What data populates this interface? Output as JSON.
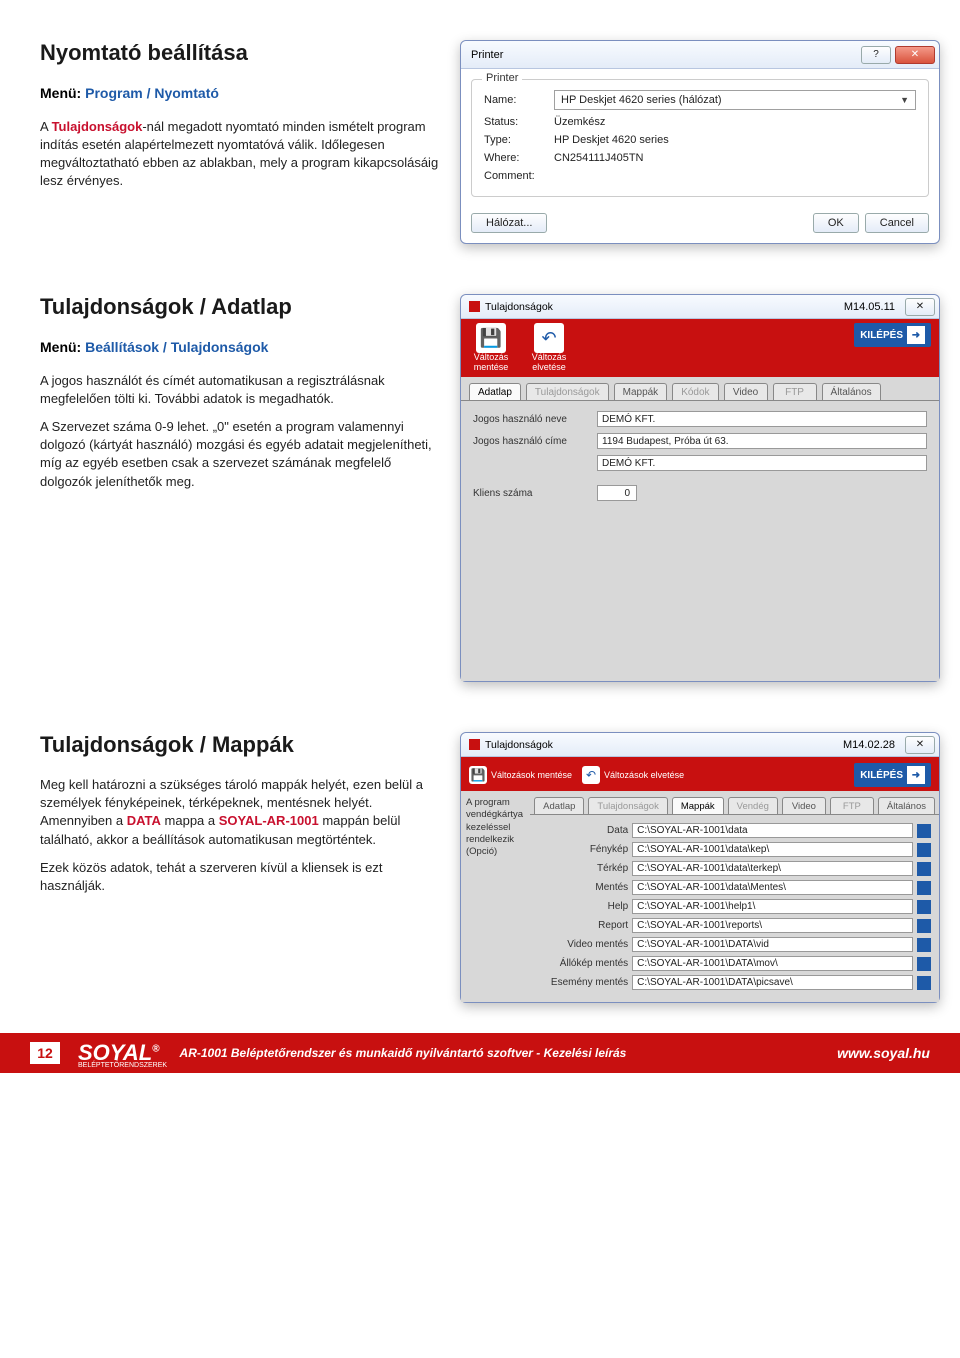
{
  "section1": {
    "heading": "Nyomtató beállítása",
    "menu_label": "Menü:",
    "menu_value": "Program / Nyomtató",
    "p1_pre": "A ",
    "p1_bold": "Tulajdonságok",
    "p1_rest": "-nál megadott nyomtató minden ismételt program indítás esetén alapértelmezett nyomtatóvá válik. Időlegesen megváltoztatható ebben az ablakban, mely a program kikapcsolásáig lesz érvényes."
  },
  "printer_dialog": {
    "title": "Printer",
    "legend": "Printer",
    "name_label": "Name:",
    "name_value": "HP Deskjet 4620 series (hálózat)",
    "status_label": "Status:",
    "status_value": "Üzemkész",
    "type_label": "Type:",
    "type_value": "HP Deskjet 4620 series",
    "where_label": "Where:",
    "where_value": "CN254111J405TN",
    "comment_label": "Comment:",
    "halozat_btn": "Hálózat...",
    "ok_btn": "OK",
    "cancel_btn": "Cancel",
    "help_char": "?"
  },
  "section2": {
    "heading": "Tulajdonságok / Adatlap",
    "menu_label": "Menü:",
    "menu_value": "Beállítások / Tulajdonságok",
    "p1": "A jogos használót és címét automatikusan a regisztrálásnak megfelelően tölti ki. További adatok is megadhatók.",
    "p2": "A Szervezet száma 0-9 lehet. „0\" esetén a program valamennyi dolgozó (kártyát használó) mozgási és egyéb adatait megjelenítheti, míg az egyéb esetben csak a szervezet számának megfelelő dolgozók jeleníthetők meg."
  },
  "adatlap_win": {
    "title": "Tulajdonságok",
    "version": "M14.05.11",
    "save_label": "Változás mentése",
    "undo_label": "Változás elvetése",
    "kilepes": "KILÉPÉS",
    "save_glyph": "💾",
    "undo_glyph": "↶",
    "tabs": [
      "Adatlap",
      "Tulajdonságok",
      "Mappák",
      "Kódok",
      "Video",
      "FTP",
      "Általános"
    ],
    "active_tab": 0,
    "row1_label": "Jogos használó neve",
    "row1_value": "DEMÓ KFT.",
    "row2_label": "Jogos használó címe",
    "row2_value": "1194 Budapest, Próba út 63.",
    "row3_value": "DEMÓ KFT.",
    "row4_label": "Kliens száma",
    "row4_value": "0"
  },
  "section3": {
    "heading": "Tulajdonságok / Mappák",
    "p1_a": "Meg kell határozni a szükséges tároló mappák helyét, ezen belül a személyek fényképeinek, térképeknek, mentésnek helyét. Amennyiben a ",
    "p1_b": "DATA",
    "p1_c": " mappa a ",
    "p1_d": "SOYAL-AR-1001",
    "p1_e": " mappán belül található, akkor a beállítások automatikusan megtörténtek.",
    "p2": "Ezek közös adatok, tehát a szerveren kívül a kliensek is ezt használják."
  },
  "mappa_win": {
    "title": "Tulajdonságok",
    "version": "M14.02.28",
    "save_label": "Változások mentése",
    "undo_label": "Változások elvetése",
    "kilepes": "KILÉPÉS",
    "side_text": "A program vendégkártya kezeléssel rendelkezik (Opció)",
    "tabs": [
      "Adatlap",
      "Tulajdonságok",
      "Mappák",
      "Vendég",
      "Video",
      "FTP",
      "Általános"
    ],
    "active_tab": 2,
    "rows": [
      {
        "label": "Data",
        "value": "C:\\SOYAL-AR-1001\\data"
      },
      {
        "label": "Fénykép",
        "value": "C:\\SOYAL-AR-1001\\data\\kep\\"
      },
      {
        "label": "Térkép",
        "value": "C:\\SOYAL-AR-1001\\data\\terkep\\"
      },
      {
        "label": "Mentés",
        "value": "C:\\SOYAL-AR-1001\\data\\Mentes\\"
      },
      {
        "label": "Help",
        "value": "C:\\SOYAL-AR-1001\\help1\\"
      },
      {
        "label": "Report",
        "value": "C:\\SOYAL-AR-1001\\reports\\"
      },
      {
        "label": "Video mentés",
        "value": "C:\\SOYAL-AR-1001\\DATA\\vid"
      },
      {
        "label": "Állókép mentés",
        "value": "C:\\SOYAL-AR-1001\\DATA\\mov\\"
      },
      {
        "label": "Esemény mentés",
        "value": "C:\\SOYAL-AR-1001\\DATA\\picsave\\"
      }
    ]
  },
  "footer": {
    "page_num": "12",
    "logo": "SOYAL",
    "logo_sub": "BELÉPTETŐRENDSZEREK",
    "reg": "®",
    "title": "AR-1001 Beléptetőrendszer és munkaidő nyilvántartó szoftver - Kezelési leírás",
    "url": "www.soyal.hu"
  }
}
